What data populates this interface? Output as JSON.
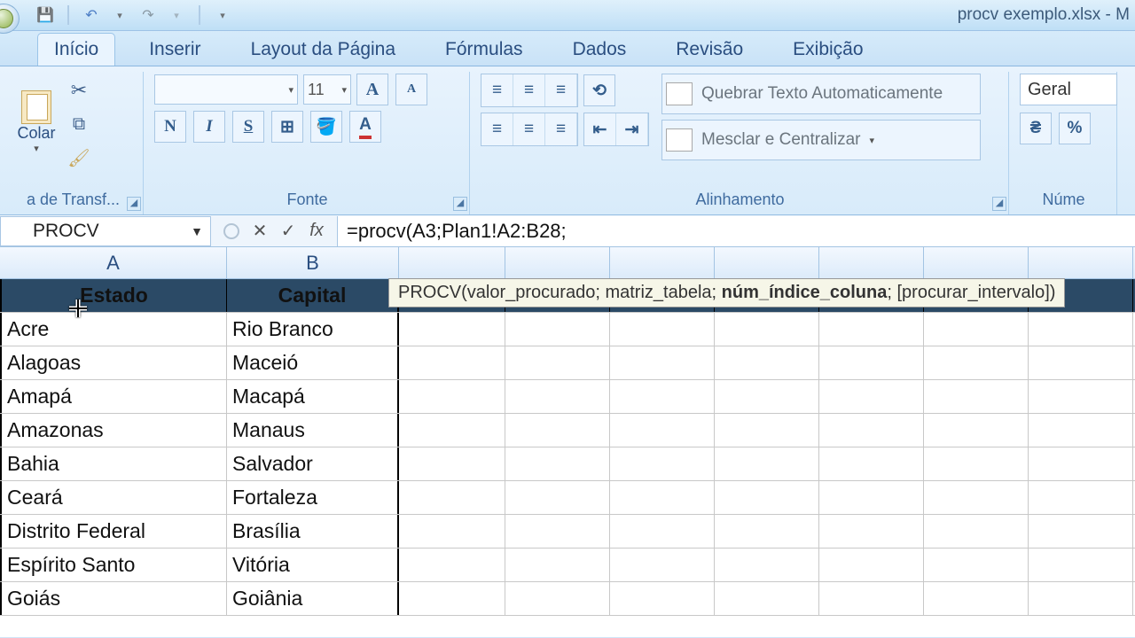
{
  "window": {
    "title": "procv exemplo.xlsx - M"
  },
  "tabs": {
    "inicio": "Início",
    "inserir": "Inserir",
    "layout": "Layout da Página",
    "formulas": "Fórmulas",
    "dados": "Dados",
    "revisao": "Revisão",
    "exibicao": "Exibição"
  },
  "ribbon": {
    "clipboard": {
      "paste": "Colar",
      "group": "a de Transf..."
    },
    "font": {
      "size": "11",
      "bold": "N",
      "italic": "I",
      "underline": "S",
      "group": "Fonte"
    },
    "alignment": {
      "wrap": "Quebrar Texto Automaticamente",
      "merge": "Mesclar e Centralizar",
      "group": "Alinhamento"
    },
    "number": {
      "format": "Geral",
      "group": "Núme"
    }
  },
  "formula_bar": {
    "name_box": "PROCV",
    "formula": "=procv(A3;Plan1!A2:B28;",
    "tooltip_fn": "PROCV",
    "tooltip_a1": "valor_procurado",
    "tooltip_a2": "matriz_tabela",
    "tooltip_a3": "núm_índice_coluna",
    "tooltip_a4": "[procurar_intervalo]"
  },
  "cols": {
    "A": "A",
    "B": "B"
  },
  "headers": {
    "estado": "Estado",
    "capital": "Capital"
  },
  "rows": [
    {
      "a": "Acre",
      "b": "Rio Branco"
    },
    {
      "a": "Alagoas",
      "b": "Maceió"
    },
    {
      "a": "Amapá",
      "b": "Macapá"
    },
    {
      "a": "Amazonas",
      "b": "Manaus"
    },
    {
      "a": "Bahia",
      "b": "Salvador"
    },
    {
      "a": "Ceará",
      "b": "Fortaleza"
    },
    {
      "a": "Distrito Federal",
      "b": "Brasília"
    },
    {
      "a": "Espírito Santo",
      "b": "Vitória"
    },
    {
      "a": "Goiás",
      "b": "Goiânia"
    }
  ]
}
